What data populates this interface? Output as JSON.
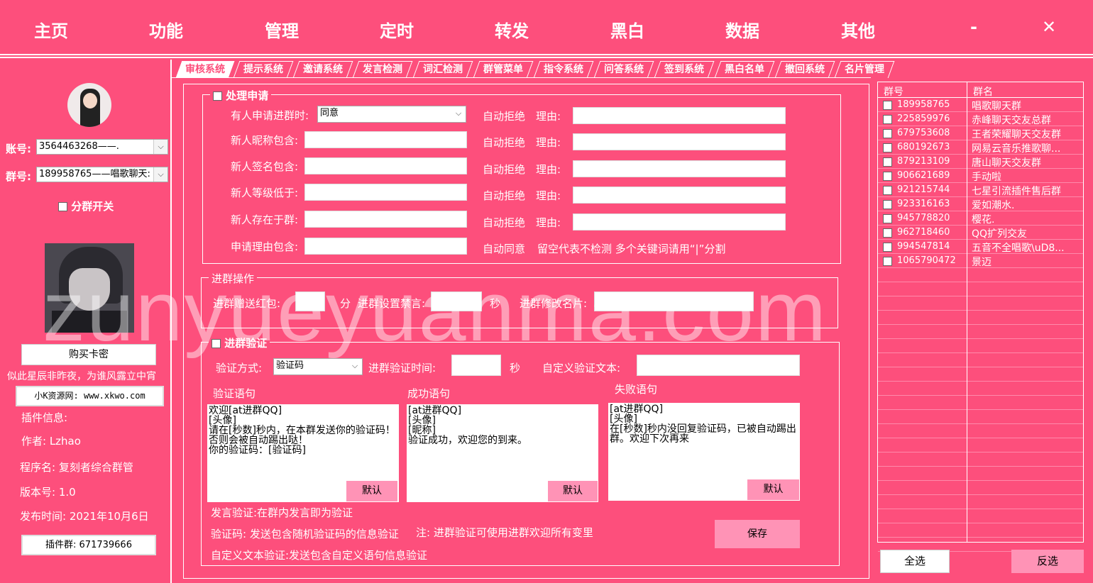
{
  "menu": [
    "主页",
    "功能",
    "管理",
    "定时",
    "转发",
    "黑白",
    "数据",
    "其他"
  ],
  "window_controls": {
    "minimize": "-",
    "close": "✕"
  },
  "left": {
    "account_label": "账号:",
    "account_value": "3564463268——.",
    "group_label": "群号:",
    "group_value": "189958765——唱歌聊天:",
    "split_switch": "分群开关",
    "buy_button": "购买卡密",
    "slogan": "似此星辰非昨夜，为谁风露立中宵",
    "resource_button": "小K资源网: www.xkwo.com",
    "plugin_info": "插件信息:",
    "author": "作者: Lzhao",
    "program": "程序名: 复刻者综合群管",
    "version": "版本号: 1.0",
    "release": "发布时间: 2021年10月6日",
    "plugin_group_button": "插件群: 671739666"
  },
  "tabs": [
    "审核系统",
    "提示系统",
    "邀请系统",
    "发言检测",
    "词汇检测",
    "群管菜单",
    "指令系统",
    "问答系统",
    "签到系统",
    "黑白名单",
    "撤回系统",
    "名片管理"
  ],
  "process": {
    "title": "处理申请",
    "apply_label": "有人申请进群时:",
    "apply_value": "同意",
    "nick_label": "新人昵称包含:",
    "sign_label": "新人签名包含:",
    "level_label": "新人等级低于:",
    "exist_label": "新人存在于群:",
    "reason_label": "申请理由包含:",
    "auto_reject": "自动拒绝",
    "reason": "理由:",
    "auto_agree": "自动同意",
    "note": "留空代表不检测   多个关键词请用“|”分割"
  },
  "join_ops": {
    "title": "进群操作",
    "redpacket": "进群赠送红包:",
    "fen": "分",
    "mute": "进群设置禁言:",
    "sec": "秒",
    "card": "进群修改名片:"
  },
  "verify": {
    "title": "进群验证",
    "method_label": "验证方式:",
    "method_value": "验证码",
    "time_label": "进群验证时间:",
    "sec": "秒",
    "custom_label": "自定义验证文本:",
    "verify_title": "验证语句",
    "success_title": "成功语句",
    "fail_title": "失败语句",
    "verify_text": "欢迎[at进群QQ]\n[头像]\n请在[秒数]秒内，在本群发送你的验证码！否则会被自动踢出哒！\n你的验证码：[验证码]",
    "success_text": "[at进群QQ]\n[头像]\n[昵称]\n验证成功，欢迎您的到来。",
    "fail_text": "[at进群QQ]\n[头像]\n在[秒数]秒内没回复验证码，已被自动踢出群。欢迎下次再来",
    "default": "默认",
    "note1": "发言验证:在群内发言即为验证",
    "note2": "验证码: 发送包含随机验证码的信息验证",
    "note3": "注: 进群验证可使用进群欢迎所有变里",
    "note4": "自定义文本验证:发送包含自定义语句信息验证",
    "save": "保存"
  },
  "grouplist": {
    "col_num": "群号",
    "col_name": "群名",
    "rows": [
      {
        "num": "189958765",
        "name": "唱歌聊天群"
      },
      {
        "num": "225859976",
        "name": "赤峰聊天交友总群"
      },
      {
        "num": "679753608",
        "name": "王者荣耀聊天交友群"
      },
      {
        "num": "680192673",
        "name": "网易云音乐推歌聊..."
      },
      {
        "num": "879213109",
        "name": "唐山聊天交友群"
      },
      {
        "num": "906621689",
        "name": "手动啦"
      },
      {
        "num": "921215744",
        "name": "七星引流插件售后群"
      },
      {
        "num": "923316163",
        "name": "爱如潮水."
      },
      {
        "num": "945778820",
        "name": "樱花."
      },
      {
        "num": "962718460",
        "name": "QQ扩列交友"
      },
      {
        "num": "994547814",
        "name": "五音不全唱歌\\uD8..."
      },
      {
        "num": "1065790472",
        "name": "景迈"
      }
    ],
    "select_all": "全选",
    "invert": "反选"
  },
  "watermark": "zunyueyuanma.com"
}
